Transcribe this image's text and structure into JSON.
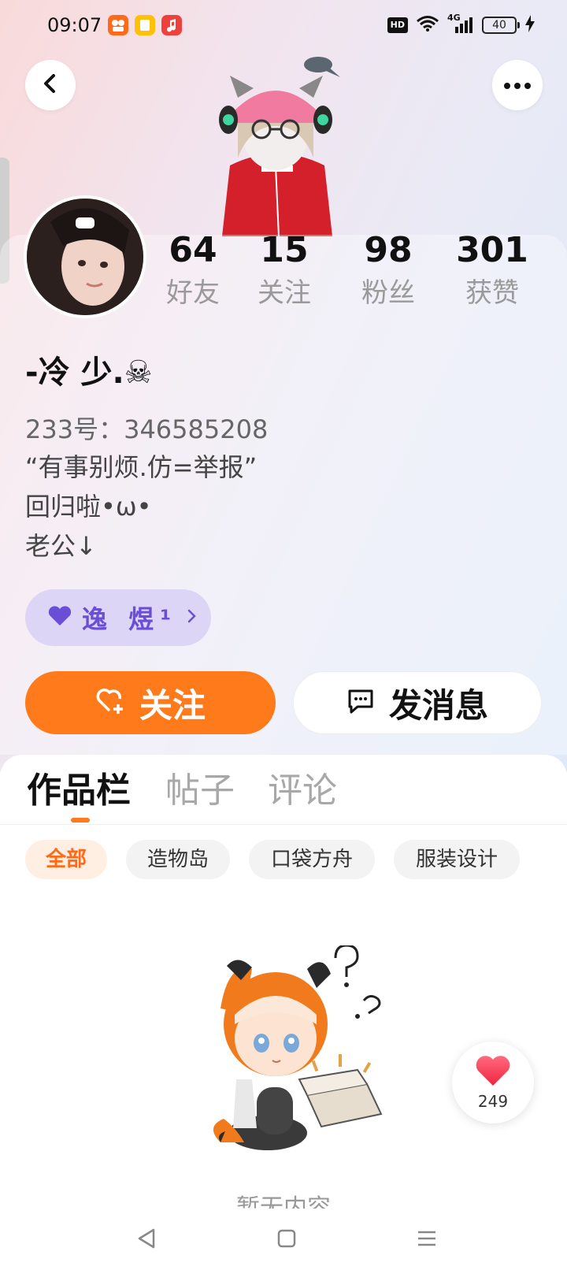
{
  "status_bar": {
    "time": "09:07",
    "hd_label": "HD",
    "network_label": "4G",
    "battery_level": "40",
    "app_icons": [
      "kuaishou-app-icon",
      "notes-app-icon",
      "music-app-icon"
    ]
  },
  "header": {
    "back_icon": "chevron-left-icon",
    "more_icon": "more-dots-icon"
  },
  "profile": {
    "stats": [
      {
        "value": "64",
        "label": "好友"
      },
      {
        "value": "15",
        "label": "关注"
      },
      {
        "value": "98",
        "label": "粉丝"
      },
      {
        "value": "301",
        "label": "获赞"
      }
    ],
    "username": "-冷 少.☠",
    "user_id": "233号：346585208",
    "bio": [
      "“有事别烦.仿=举报”",
      "回归啦•ω•",
      "老公↓"
    ],
    "tag": {
      "text": "逸 煜¹",
      "icon": "heart-icon"
    }
  },
  "actions": {
    "follow_label": "关注",
    "message_label": "发消息"
  },
  "tabs": [
    {
      "label": "作品栏",
      "active": true
    },
    {
      "label": "帖子",
      "active": false
    },
    {
      "label": "评论",
      "active": false
    }
  ],
  "filter_chips": [
    {
      "label": "全部",
      "active": true
    },
    {
      "label": "造物岛",
      "active": false
    },
    {
      "label": "口袋方舟",
      "active": false
    },
    {
      "label": "服装设计",
      "active": false
    }
  ],
  "empty_state": {
    "text": "暂无内容"
  },
  "like_float": {
    "count": "249"
  },
  "colors": {
    "accent": "#ff7a1a",
    "tag_bg": "#ddd5f5",
    "tag_text": "#6a4fd6",
    "heart": "#ff3b55"
  }
}
